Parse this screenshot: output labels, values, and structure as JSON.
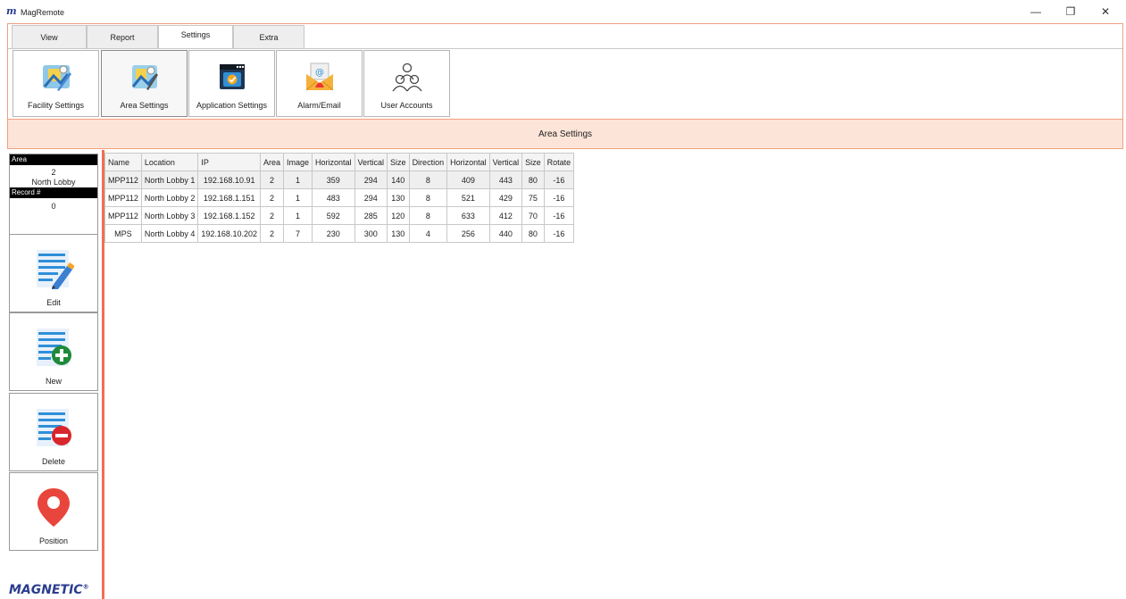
{
  "app": {
    "title": "MagRemote",
    "logo_glyph": "m",
    "window_controls": {
      "minimize": "—",
      "maximize": "❐",
      "close": "✕"
    }
  },
  "tabs": [
    {
      "label": "View",
      "active": false
    },
    {
      "label": "Report",
      "active": false
    },
    {
      "label": "Settings",
      "active": true
    },
    {
      "label": "Extra",
      "active": false
    }
  ],
  "toolbar": [
    {
      "label": "Facility Settings",
      "icon": "facility-settings-icon"
    },
    {
      "label": "Area Settings",
      "icon": "area-settings-icon",
      "selected": true
    },
    {
      "label": "Application Settings",
      "icon": "application-settings-icon"
    },
    {
      "label": "Alarm/Email",
      "icon": "alarm-email-icon"
    },
    {
      "label": "User Accounts",
      "icon": "user-accounts-icon"
    }
  ],
  "section": {
    "title": "Area Settings"
  },
  "info": {
    "area_label": "Area",
    "area_value": "2",
    "area_name": "North Lobby",
    "record_label": "Record #",
    "record_value": "0"
  },
  "side_buttons": [
    {
      "label": "Edit",
      "icon": "edit-icon"
    },
    {
      "label": "New",
      "icon": "new-icon"
    },
    {
      "label": "Delete",
      "icon": "delete-icon"
    },
    {
      "label": "Position",
      "icon": "position-pin-icon"
    }
  ],
  "brand": {
    "text": "MAGNETIC",
    "mark": "®"
  },
  "table": {
    "columns": [
      "Name",
      "Location",
      "IP",
      "Area",
      "Image",
      "Horizontal",
      "Vertical",
      "Size",
      "Direction",
      "Horizontal",
      "Vertical",
      "Size",
      "Rotate"
    ],
    "rows": [
      [
        "MPP112",
        "North Lobby 1",
        "192.168.10.91",
        "2",
        "1",
        "359",
        "294",
        "140",
        "8",
        "409",
        "443",
        "80",
        "-16"
      ],
      [
        "MPP112",
        "North Lobby 2",
        "192.168.1.151",
        "2",
        "1",
        "483",
        "294",
        "130",
        "8",
        "521",
        "429",
        "75",
        "-16"
      ],
      [
        "MPP112",
        "North Lobby 3",
        "192.168.1.152",
        "2",
        "1",
        "592",
        "285",
        "120",
        "8",
        "633",
        "412",
        "70",
        "-16"
      ],
      [
        "MPS",
        "North Lobby 4",
        "192.168.10.202",
        "2",
        "7",
        "230",
        "300",
        "130",
        "4",
        "256",
        "440",
        "80",
        "-16"
      ]
    ]
  },
  "colors": {
    "accent": "#f07050",
    "header_bg": "#fde4d8",
    "brand": "#2a3d8f"
  }
}
